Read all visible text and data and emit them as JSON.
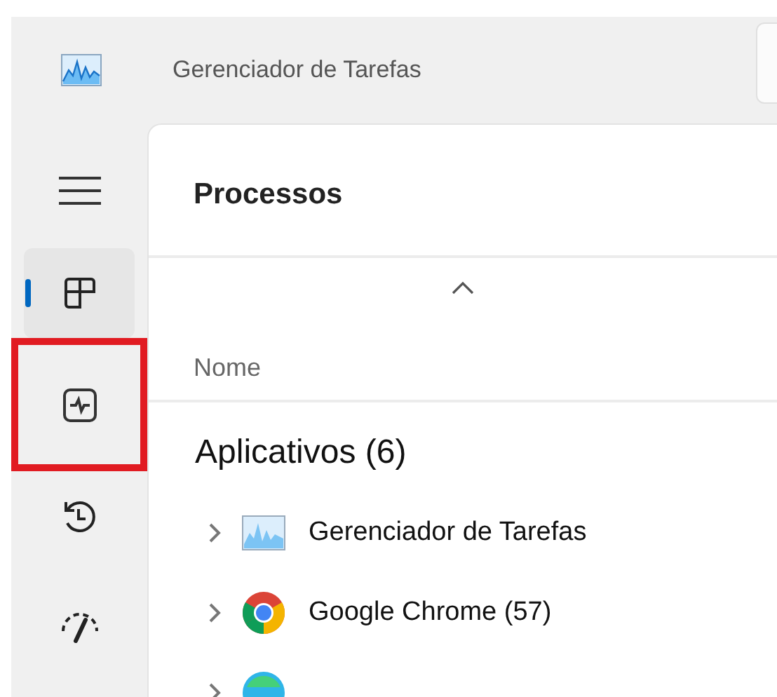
{
  "window": {
    "title": "Gerenciador de Tarefas"
  },
  "sidebar": {
    "items": [
      {
        "kind": "processes",
        "selected": true,
        "highlighted": false
      },
      {
        "kind": "performance",
        "selected": false,
        "highlighted": true
      },
      {
        "kind": "history",
        "selected": false,
        "highlighted": false
      },
      {
        "kind": "startup",
        "selected": false,
        "highlighted": false
      }
    ]
  },
  "page": {
    "title": "Processos",
    "column": "Nome"
  },
  "group": {
    "title": "Aplicativos (6)"
  },
  "rows": [
    {
      "kind": "taskmgr",
      "name": "Gerenciador de Tarefas"
    },
    {
      "kind": "chrome",
      "name": "Google Chrome (57)"
    },
    {
      "kind": "edge"
    }
  ]
}
